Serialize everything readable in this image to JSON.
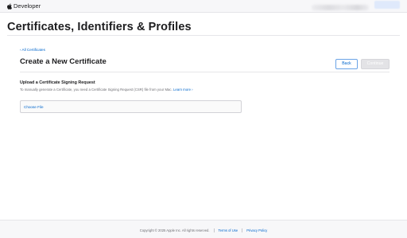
{
  "header": {
    "brand": "Developer",
    "logo_icon": "apple-logo-icon"
  },
  "page": {
    "title": "Certificates, Identifiers & Profiles"
  },
  "content": {
    "breadcrumb": "‹ All Certificates",
    "section_title": "Create a New Certificate",
    "buttons": {
      "back": "Back",
      "continue": "Continue"
    },
    "upload": {
      "heading": "Upload a Certificate Signing Request",
      "description": "To manually generate a Certificate, you need a Certificate Signing Request (CSR) file from your Mac.",
      "learn_more": "Learn more ›",
      "choose_file": "Choose File"
    }
  },
  "footer": {
    "copyright": "Copyright © 2025 Apple Inc. All rights reserved.",
    "terms": "Terms of Use",
    "privacy": "Privacy Policy"
  },
  "colors": {
    "link": "#0066cc",
    "text": "#1d1d1f",
    "secondary_text": "#6e6e73",
    "disabled_button": "#e3e3e6"
  }
}
